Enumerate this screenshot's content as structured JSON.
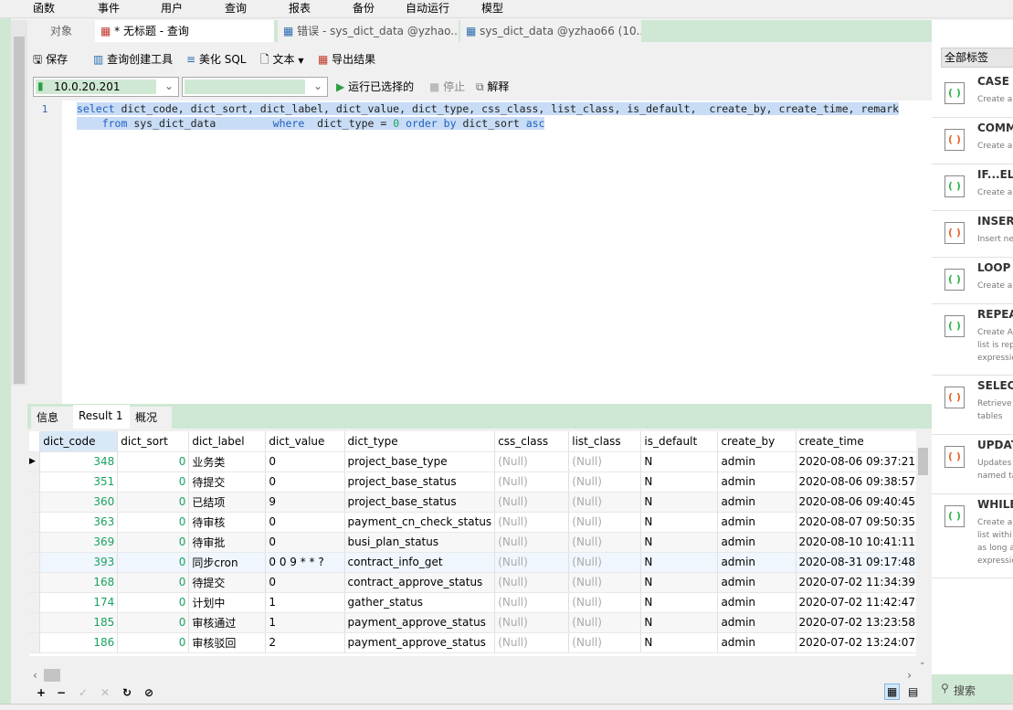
{
  "menu": [
    "函数",
    "事件",
    "用户",
    "查询",
    "报表",
    "备份",
    "自动运行",
    "模型"
  ],
  "tabs": [
    {
      "label": "对象"
    },
    {
      "label": "* 无标题 - 查询"
    },
    {
      "label": "错误 - sys_dict_data @yzhao..."
    },
    {
      "label": "sys_dict_data @yzhao66 (10..."
    }
  ],
  "toolbar": {
    "save": "保存",
    "query_builder": "查询创建工具",
    "beautify": "美化 SQL",
    "text": "文本",
    "export": "导出结果"
  },
  "connection": {
    "value": "10.0.20.201",
    "database": "",
    "run_selected": "运行已选择的",
    "stop": "停止",
    "explain": "解释"
  },
  "editor": {
    "line_number": "1",
    "line1": "select dict_code, dict_sort, dict_label, dict_value, dict_type, css_class, list_class, is_default,  create_by, create_time, remark",
    "line2": "    from sys_dict_data         where  dict_type = 0 order by dict_sort asc"
  },
  "result_tabs": [
    "信息",
    "Result 1",
    "概况"
  ],
  "grid": {
    "columns": [
      "dict_code",
      "dict_sort",
      "dict_label",
      "dict_value",
      "dict_type",
      "css_class",
      "list_class",
      "is_default",
      "create_by",
      "create_time"
    ],
    "rows": [
      [
        "348",
        "0",
        "业务类",
        "0",
        "project_base_type",
        "(Null)",
        "(Null)",
        "N",
        "admin",
        "2020-08-06 09:37:21"
      ],
      [
        "351",
        "0",
        "待提交",
        "0",
        "project_base_status",
        "(Null)",
        "(Null)",
        "N",
        "admin",
        "2020-08-06 09:38:57"
      ],
      [
        "360",
        "0",
        "已结项",
        "9",
        "project_base_status",
        "(Null)",
        "(Null)",
        "N",
        "admin",
        "2020-08-06 09:40:45"
      ],
      [
        "363",
        "0",
        "待审核",
        "0",
        "payment_cn_check_status",
        "(Null)",
        "(Null)",
        "N",
        "admin",
        "2020-08-07 09:50:35"
      ],
      [
        "369",
        "0",
        "待审批",
        "0",
        "busi_plan_status",
        "(Null)",
        "(Null)",
        "N",
        "admin",
        "2020-08-10 10:41:11"
      ],
      [
        "393",
        "0",
        "同步cron",
        "0 0 9 * * ?",
        "contract_info_get",
        "(Null)",
        "(Null)",
        "N",
        "admin",
        "2020-08-31 09:17:48"
      ],
      [
        "168",
        "0",
        "待提交",
        "0",
        "contract_approve_status",
        "(Null)",
        "(Null)",
        "N",
        "admin",
        "2020-07-02 11:34:39"
      ],
      [
        "174",
        "0",
        "计划中",
        "1",
        "gather_status",
        "(Null)",
        "(Null)",
        "N",
        "admin",
        "2020-07-02 11:42:47"
      ],
      [
        "185",
        "0",
        "审核通过",
        "1",
        "payment_approve_status",
        "(Null)",
        "(Null)",
        "N",
        "admin",
        "2020-07-02 13:23:58"
      ],
      [
        "186",
        "0",
        "审核驳回",
        "2",
        "payment_approve_status",
        "(Null)",
        "(Null)",
        "N",
        "admin",
        "2020-07-02 13:24:07"
      ]
    ]
  },
  "snippets": {
    "filter": "全部标签",
    "items": [
      {
        "title": "CASE",
        "desc": "Create a"
      },
      {
        "title": "COMM",
        "desc": "Create a"
      },
      {
        "title": "IF...ELS",
        "desc": "Create a"
      },
      {
        "title": "INSERT",
        "desc": "Insert ne"
      },
      {
        "title": "LOOP",
        "desc": "Create a"
      },
      {
        "title": "REPEA",
        "desc": "Create A\nlist is rep\nexpressio"
      },
      {
        "title": "SELECT",
        "desc": "Retrieve\ntables"
      },
      {
        "title": "UPDAT",
        "desc": "Updates\nnamed ta"
      },
      {
        "title": "WHILE",
        "desc": "Create a\nlist withi\nas long a\nexpressio"
      }
    ],
    "search": "搜索"
  },
  "colors": {
    "accent_green": "#cfe8d4",
    "selection": "#c8dcf5",
    "keyword": "#2060c0"
  }
}
